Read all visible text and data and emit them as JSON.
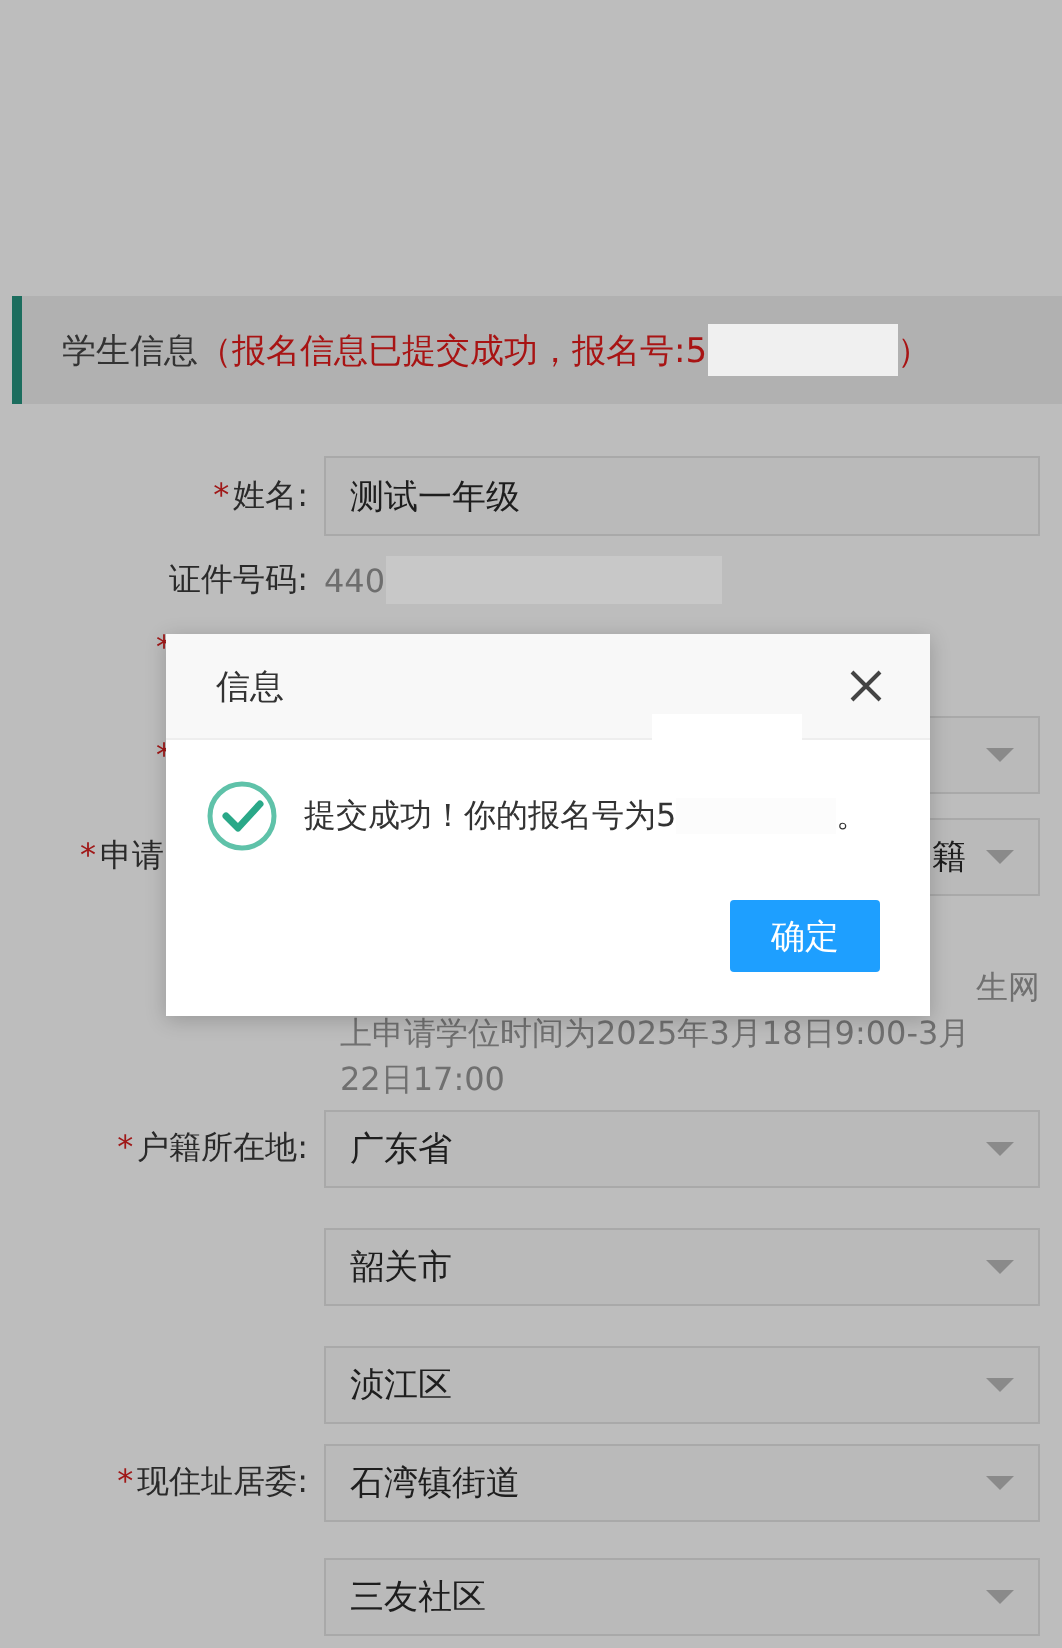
{
  "section": {
    "title": "学生信息",
    "notice": "（报名信息已提交成功，报名号:5",
    "notice_end": "）"
  },
  "fields": [
    {
      "kind": "text",
      "mark": "*",
      "label": "姓名:",
      "value": "测试一年级"
    },
    {
      "kind": "static",
      "label": "证件号码:",
      "value": "440"
    },
    {
      "kind": "covered",
      "mark": "*"
    },
    {
      "kind": "select",
      "mark": "*"
    },
    {
      "kind": "select_cut",
      "mark": "*",
      "label": "申请",
      "value": "籍"
    },
    {
      "kind": "note",
      "lines": [
        "生网",
        "上申请学位时间为2025年3月18日9:00-3月",
        "22日17:00"
      ]
    },
    {
      "kind": "select",
      "mark": "*",
      "label": "户籍所在地:",
      "value": "广东省"
    },
    {
      "kind": "select",
      "value": "韶关市"
    },
    {
      "kind": "select",
      "value": "浈江区"
    },
    {
      "kind": "select",
      "mark": "*",
      "label": "现住址居委:",
      "value": "石湾镇街道"
    },
    {
      "kind": "select",
      "value": "三友社区"
    }
  ],
  "dialog": {
    "title": "信息",
    "message": "提交成功！你的报名号为5",
    "message_end": "。",
    "button": "确定"
  }
}
